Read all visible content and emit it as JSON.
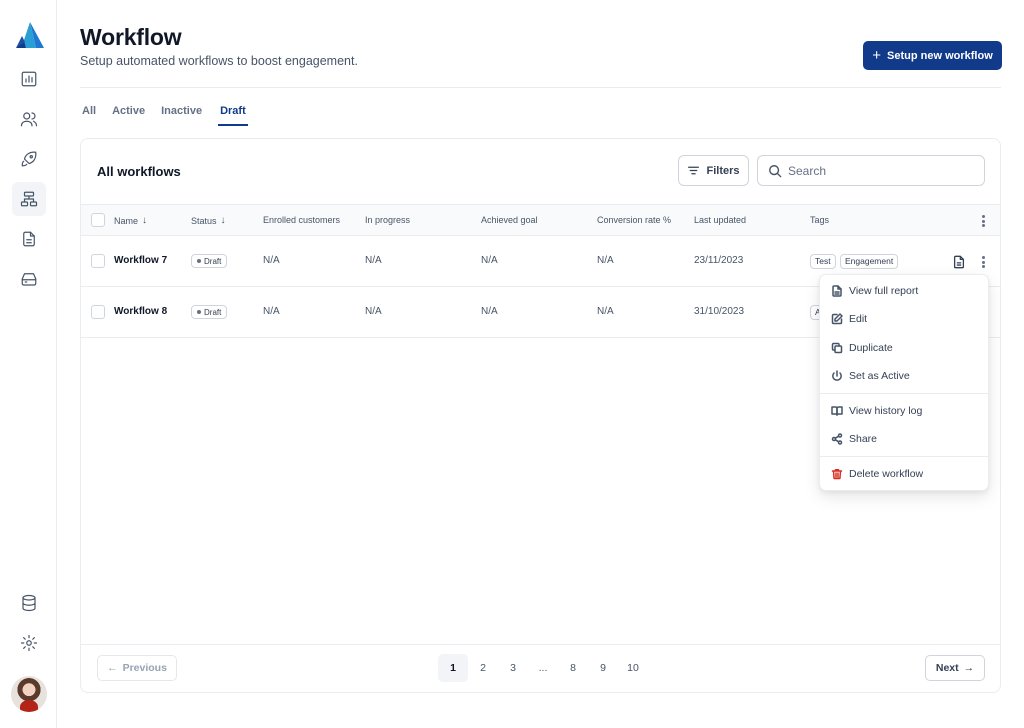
{
  "header": {
    "title": "Workflow",
    "subtitle": "Setup automated workflows to boost engagement.",
    "primary_button": "Setup new workflow"
  },
  "tabs": [
    {
      "label": "All"
    },
    {
      "label": "Active"
    },
    {
      "label": "Inactive"
    },
    {
      "label": "Draft",
      "active": true
    }
  ],
  "card": {
    "title": "All workflows",
    "filters_label": "Filters",
    "search_placeholder": "Search"
  },
  "table": {
    "columns": [
      "Name",
      "Status",
      "Enrolled customers",
      "In progress",
      "Achieved goal",
      "Conversion rate %",
      "Last updated",
      "Tags"
    ],
    "rows": [
      {
        "name": "Workflow 7",
        "status": "Draft",
        "enrolled": "N/A",
        "in_progress": "N/A",
        "achieved": "N/A",
        "conversion": "N/A",
        "updated": "23/11/2023",
        "tags": [
          "Test",
          "Engagement"
        ]
      },
      {
        "name": "Workflow 8",
        "status": "Draft",
        "enrolled": "N/A",
        "in_progress": "N/A",
        "achieved": "N/A",
        "conversion": "N/A",
        "updated": "31/10/2023",
        "tags": [
          "A"
        ]
      }
    ]
  },
  "menu": {
    "items": [
      "View full report",
      "Edit",
      "Duplicate",
      "Set as Active",
      "View history log",
      "Share",
      "Delete workflow"
    ]
  },
  "pagination": {
    "previous": "Previous",
    "next": "Next",
    "pages": [
      "1",
      "2",
      "3",
      "...",
      "8",
      "9",
      "10"
    ],
    "current": "1"
  },
  "colors": {
    "primary": "#123a8a",
    "danger": "#d92d20",
    "border": "#eaecf0"
  }
}
